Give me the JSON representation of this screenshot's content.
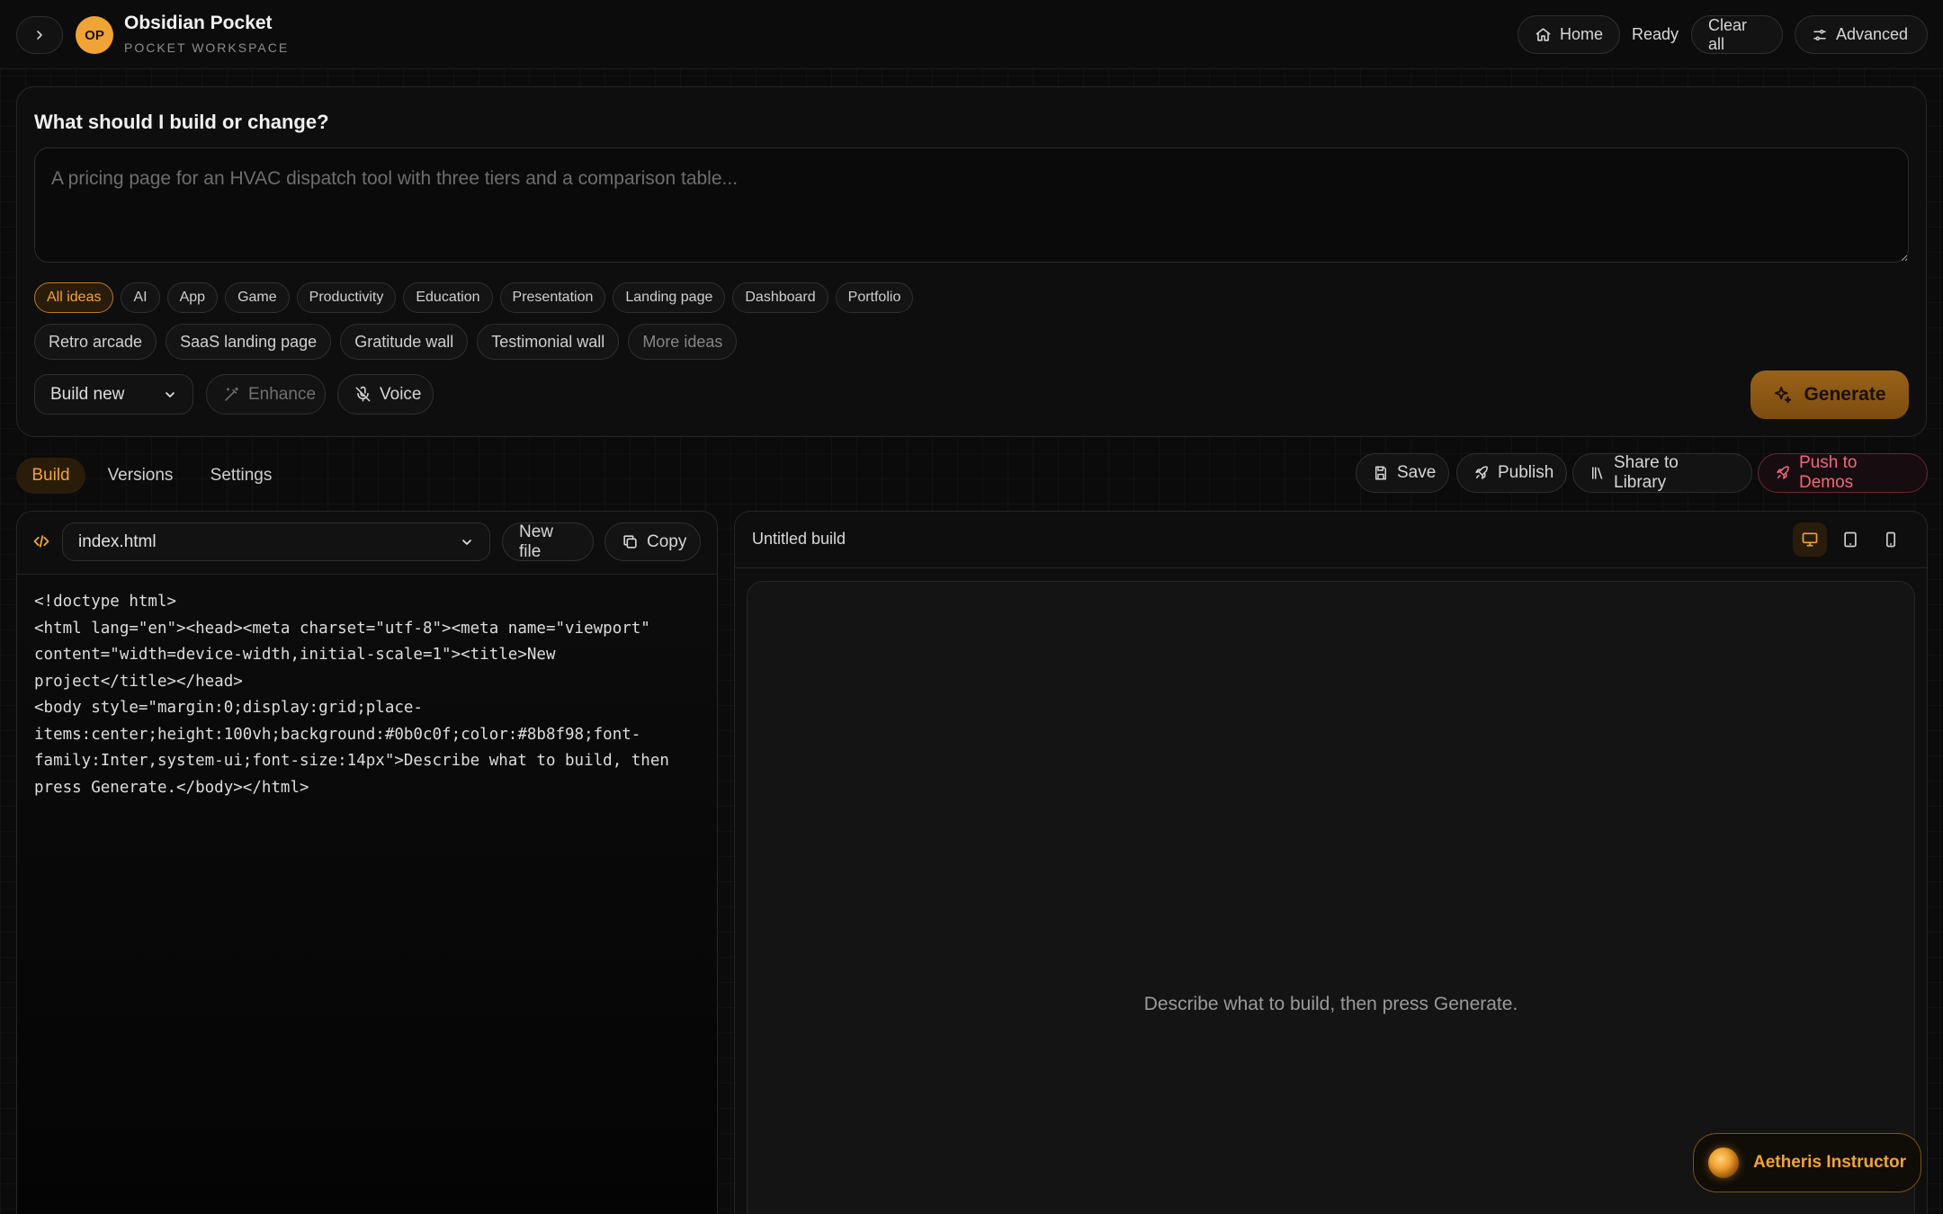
{
  "header": {
    "logo_initials": "OP",
    "app_title": "Obsidian Pocket",
    "app_subtitle": "POCKET WORKSPACE",
    "home_label": "Home",
    "status": "Ready",
    "clear_label": "Clear all",
    "advanced_label": "Advanced"
  },
  "prompt": {
    "heading": "What should I build or change?",
    "placeholder": "A pricing page for an HVAC dispatch tool with three tiers and a comparison table...",
    "value": "",
    "categories": [
      "All ideas",
      "AI",
      "App",
      "Game",
      "Productivity",
      "Education",
      "Presentation",
      "Landing page",
      "Dashboard",
      "Portfolio"
    ],
    "active_category": "All ideas",
    "ideas": [
      "Retro arcade",
      "SaaS landing page",
      "Gratitude wall",
      "Testimonial wall"
    ],
    "more_ideas_label": "More ideas",
    "mode_value": "Build new",
    "enhance_label": "Enhance",
    "voice_label": "Voice",
    "generate_label": "Generate"
  },
  "tabs": {
    "build": "Build",
    "versions": "Versions",
    "settings": "Settings",
    "active": "Build"
  },
  "actions": {
    "save": "Save",
    "publish": "Publish",
    "share": "Share to Library",
    "push": "Push to Demos"
  },
  "editor": {
    "file_value": "index.html",
    "new_file_label": "New file",
    "copy_label": "Copy",
    "code": "<!doctype html>\n<html lang=\"en\"><head><meta charset=\"utf-8\"><meta name=\"viewport\" content=\"width=device-width,initial-scale=1\"><title>New project</title></head>\n<body style=\"margin:0;display:grid;place-items:center;height:100vh;background:#0b0c0f;color:#8b8f98;font-family:Inter,system-ui;font-size:14px\">Describe what to build, then press Generate.</body></html>"
  },
  "preview": {
    "title": "Untitled build",
    "active_device": "desktop",
    "message": "Describe what to build, then press Generate."
  },
  "assistant": {
    "label": "Aetheris Instructor"
  },
  "colors": {
    "accent": "#f0a434",
    "accent_bg": "#2a1c0b",
    "danger": "#f2677c",
    "background": "#0b0b0b",
    "panel": "#0e0e0e",
    "border": "#262626"
  },
  "icons": {
    "collapse": "chevron-right-icon",
    "home": "home-icon",
    "advanced": "sliders-icon",
    "enhance": "magic-wand-icon",
    "voice": "mic-off-icon",
    "generate": "sparkles-icon",
    "save": "save-icon",
    "publish": "rocket-icon",
    "share": "library-icon",
    "push": "rocket-icon",
    "code": "code-icon",
    "copy": "copy-icon",
    "devices": [
      "monitor-icon",
      "tablet-icon",
      "phone-icon"
    ]
  }
}
